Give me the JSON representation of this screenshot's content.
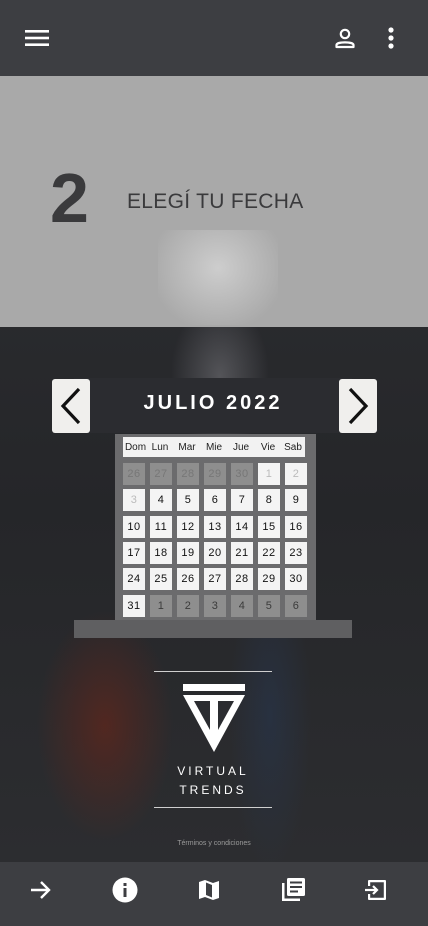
{
  "topbar": {
    "menu_icon": "menu-icon",
    "account_icon": "account-icon",
    "more_icon": "more-vert-icon"
  },
  "step": {
    "number": "2",
    "title": "ELEGÍ TU FECHA"
  },
  "calendar": {
    "month_label": "JULIO 2022",
    "prev_icon": "chevron-left-icon",
    "next_icon": "chevron-right-icon",
    "weekdays": [
      "Dom",
      "Lun",
      "Mar",
      "Mie",
      "Jue",
      "Vie",
      "Sab"
    ],
    "days": [
      {
        "t": "26",
        "s": "prev"
      },
      {
        "t": "27",
        "s": "prev"
      },
      {
        "t": "28",
        "s": "prev"
      },
      {
        "t": "29",
        "s": "prev"
      },
      {
        "t": "30",
        "s": "prev"
      },
      {
        "t": "1",
        "s": "prevlight"
      },
      {
        "t": "2",
        "s": "prevlight"
      },
      {
        "t": "3",
        "s": "prevlight"
      },
      {
        "t": "4",
        "s": "cur"
      },
      {
        "t": "5",
        "s": "cur"
      },
      {
        "t": "6",
        "s": "cur"
      },
      {
        "t": "7",
        "s": "cur"
      },
      {
        "t": "8",
        "s": "cur"
      },
      {
        "t": "9",
        "s": "cur"
      },
      {
        "t": "10",
        "s": "cur"
      },
      {
        "t": "11",
        "s": "cur"
      },
      {
        "t": "12",
        "s": "cur"
      },
      {
        "t": "13",
        "s": "cur"
      },
      {
        "t": "14",
        "s": "cur"
      },
      {
        "t": "15",
        "s": "cur"
      },
      {
        "t": "16",
        "s": "cur"
      },
      {
        "t": "17",
        "s": "cur"
      },
      {
        "t": "18",
        "s": "cur"
      },
      {
        "t": "19",
        "s": "cur"
      },
      {
        "t": "20",
        "s": "cur"
      },
      {
        "t": "21",
        "s": "cur"
      },
      {
        "t": "22",
        "s": "cur"
      },
      {
        "t": "23",
        "s": "cur"
      },
      {
        "t": "24",
        "s": "cur"
      },
      {
        "t": "25",
        "s": "cur"
      },
      {
        "t": "26",
        "s": "cur"
      },
      {
        "t": "27",
        "s": "cur"
      },
      {
        "t": "28",
        "s": "cur"
      },
      {
        "t": "29",
        "s": "cur"
      },
      {
        "t": "30",
        "s": "cur"
      },
      {
        "t": "31",
        "s": "cur"
      },
      {
        "t": "1",
        "s": "next"
      },
      {
        "t": "2",
        "s": "next"
      },
      {
        "t": "3",
        "s": "next"
      },
      {
        "t": "4",
        "s": "next"
      },
      {
        "t": "5",
        "s": "next"
      },
      {
        "t": "6",
        "s": "next"
      }
    ]
  },
  "brand": {
    "line1": "VIRTUAL",
    "line2": "TRENDS",
    "logo_icon": "virtual-trends-logo-icon"
  },
  "footer": {
    "terms": "Términos y condiciones"
  },
  "bottom_nav": [
    {
      "icon": "arrow-forward-icon"
    },
    {
      "icon": "info-icon"
    },
    {
      "icon": "map-icon"
    },
    {
      "icon": "library-books-icon"
    },
    {
      "icon": "exit-to-app-icon"
    }
  ],
  "colors": {
    "bar": "#3d3e42",
    "hero_top": "#a9a9a9",
    "calendar_header": "#2b2c30",
    "cell": "#f4f4f4",
    "cell_muted": "#8e8e8e"
  }
}
